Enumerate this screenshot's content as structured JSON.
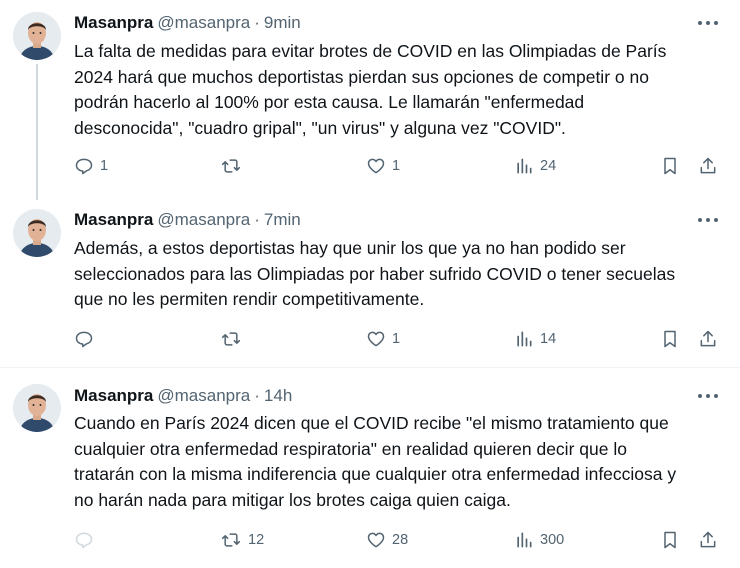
{
  "tweets": [
    {
      "name": "Masanpra",
      "handle": "@masanpra",
      "separator": "·",
      "time": "9min",
      "lines": [
        "La falta de medidas para evitar brotes de COVID en las Olimpiadas de París",
        "2024 hará que muchos deportistas pierdan sus opciones de competir o no",
        "podrán hacerlo al 100% por esta causa. Le llamarán \"enfermedad",
        "desconocida\", \"cuadro gripal\", \"un virus\" y alguna vez \"COVID\"."
      ],
      "replies": "1",
      "retweets": "",
      "likes": "1",
      "views": "24"
    },
    {
      "name": "Masanpra",
      "handle": "@masanpra",
      "separator": "·",
      "time": "7min",
      "lines": [
        "Además, a estos deportistas hay que unir los que ya no han podido ser",
        "seleccionados para las Olimpiadas por haber sufrido COVID o tener secuelas",
        "que no les permiten rendir competitivamente."
      ],
      "replies": "",
      "retweets": "",
      "likes": "1",
      "views": "14"
    },
    {
      "name": "Masanpra",
      "handle": "@masanpra",
      "separator": "·",
      "time": "14h",
      "lines": [
        "Cuando en París 2024 dicen que el COVID recibe \"el mismo tratamiento que",
        "cualquier otra enfermedad respiratoria\" en realidad quieren decir que lo",
        "tratarán con la misma indiferencia que cualquier otra enfermedad infecciosa y",
        "no harán nada para mitigar los brotes caiga quien caiga."
      ],
      "replies": "",
      "retweets": "12",
      "likes": "28",
      "views": "300"
    }
  ],
  "icons": {
    "reply": "reply-icon",
    "retweet": "retweet-icon",
    "like": "heart-icon",
    "views": "views-icon",
    "bookmark": "bookmark-icon",
    "share": "share-icon",
    "more": "more-icon"
  },
  "colors": {
    "text": "#0f1419",
    "secondary": "#536471",
    "thread_line": "#cfd9de",
    "divider": "#eff3f4"
  }
}
